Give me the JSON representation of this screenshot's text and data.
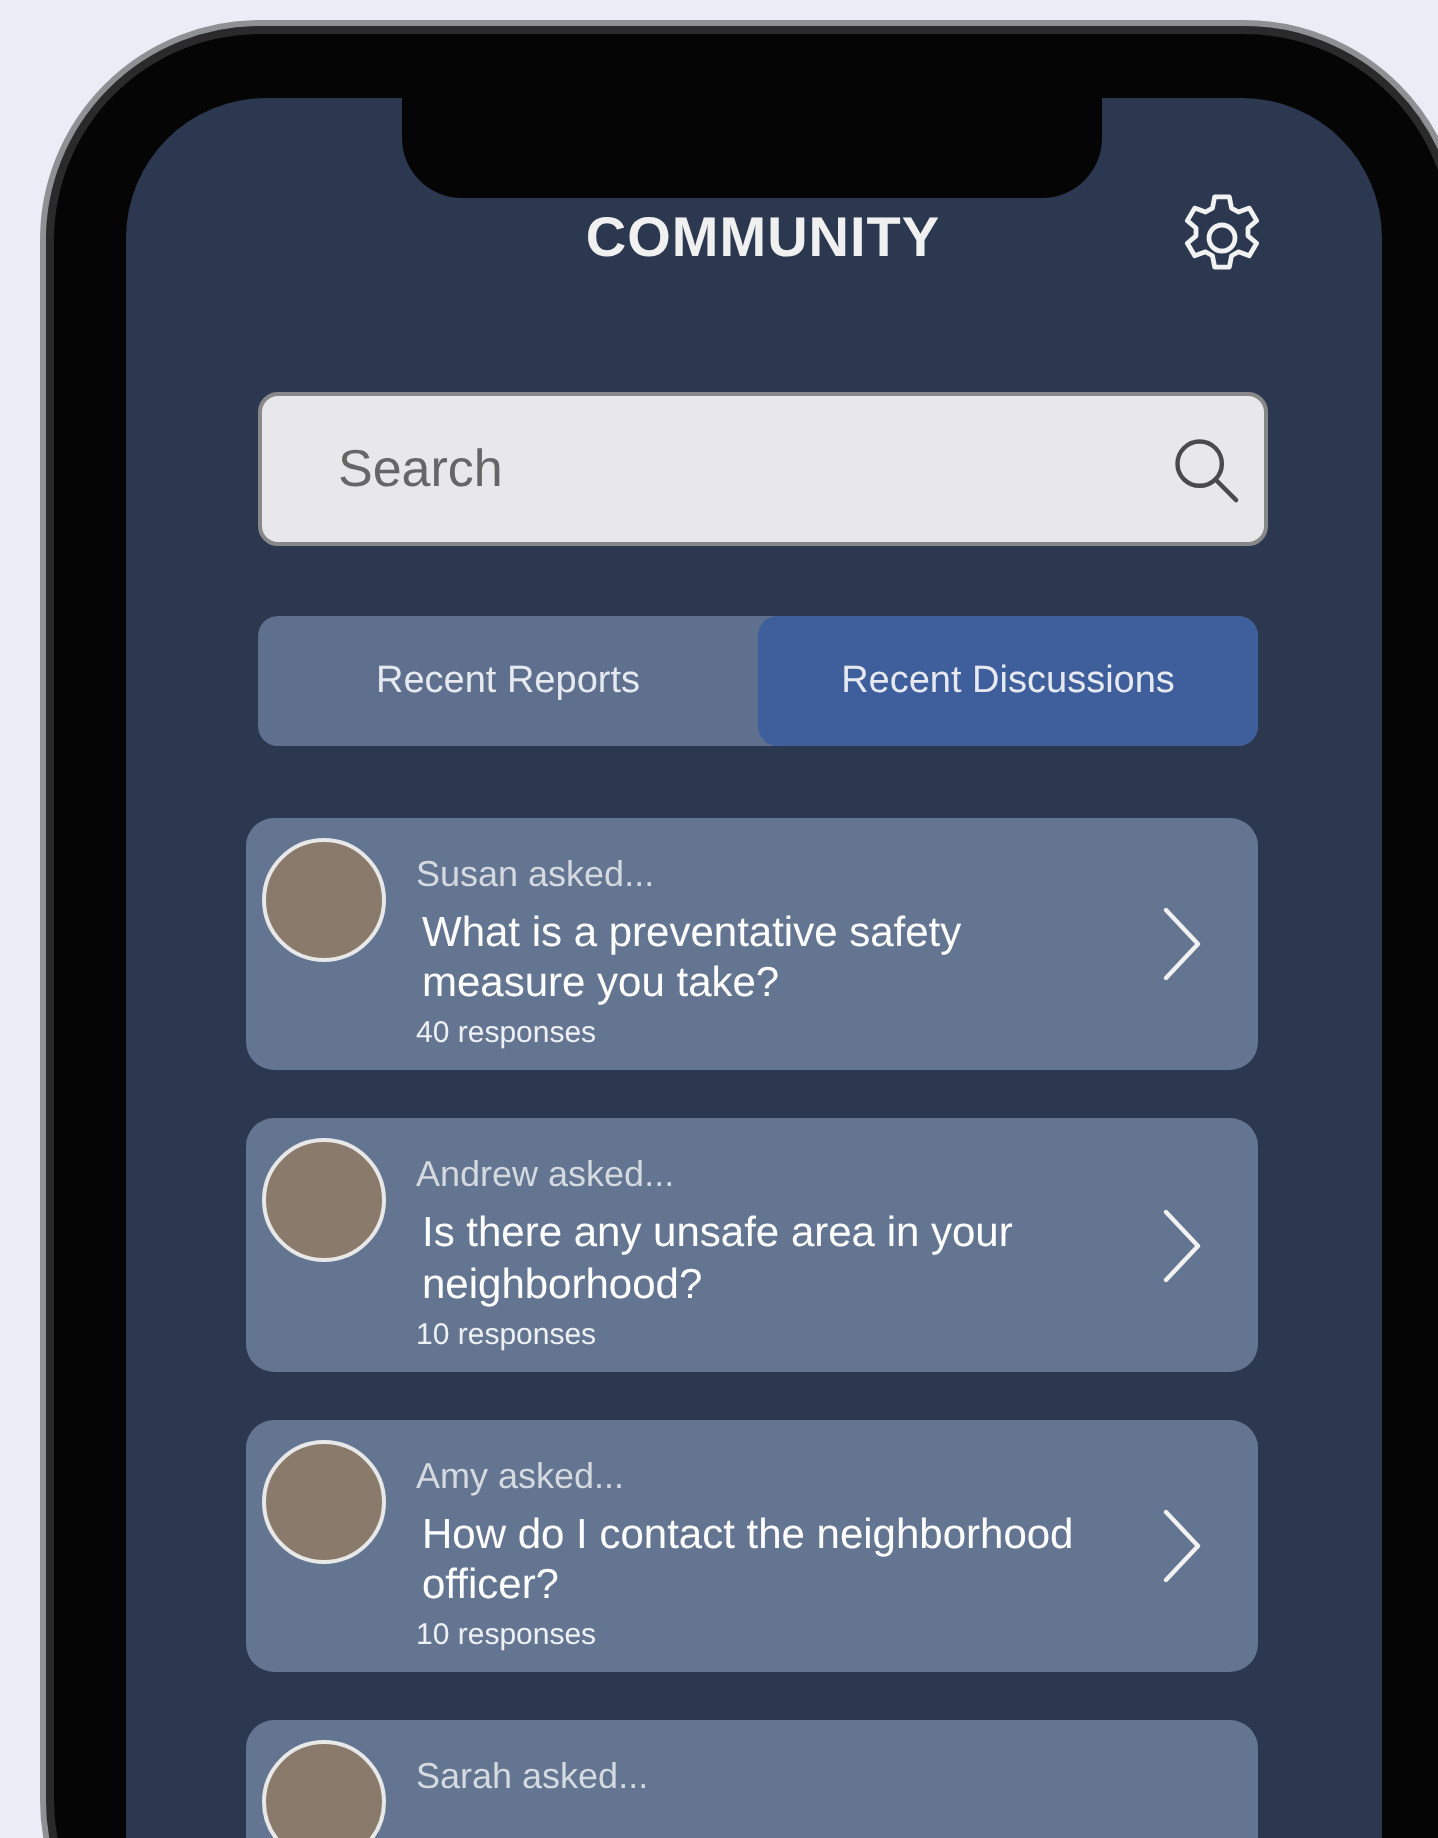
{
  "header": {
    "title": "COMMUNITY"
  },
  "search": {
    "placeholder": "Search"
  },
  "tabs": [
    {
      "label": "Recent Reports",
      "selected": false
    },
    {
      "label": "Recent Discussions",
      "selected": true
    }
  ],
  "discussions": [
    {
      "asker": "Susan asked...",
      "question": "What is a preventative safety measure you take?",
      "responses": "40 responses"
    },
    {
      "asker": "Andrew asked...",
      "question": "Is there any unsafe area in your neighborhood?",
      "responses": "10 responses"
    },
    {
      "asker": "Amy asked...",
      "question": "How do I contact the neighborhood officer?",
      "responses": "10 responses"
    },
    {
      "asker": "Sarah asked..."
    }
  ]
}
